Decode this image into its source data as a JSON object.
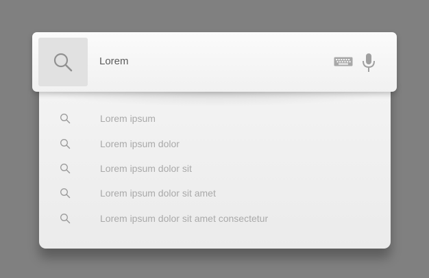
{
  "search": {
    "value": "Lorem",
    "icon": "search-icon",
    "keyboard_icon": "keyboard-icon",
    "mic_icon": "microphone-icon"
  },
  "suggestions": [
    {
      "text": "Lorem ipsum"
    },
    {
      "text": "Lorem ipsum dolor"
    },
    {
      "text": "Lorem ipsum dolor sit"
    },
    {
      "text": "Lorem ipsum dolor sit amet"
    },
    {
      "text": "Lorem ipsum dolor sit amet consectetur"
    }
  ],
  "colors": {
    "background": "#808080",
    "panel": "#f2f2f2",
    "search_button": "#e1e1e1",
    "suggestion_text": "#a9a9a9",
    "input_text": "#5b5b5b",
    "icon": "#9a9a9a"
  }
}
